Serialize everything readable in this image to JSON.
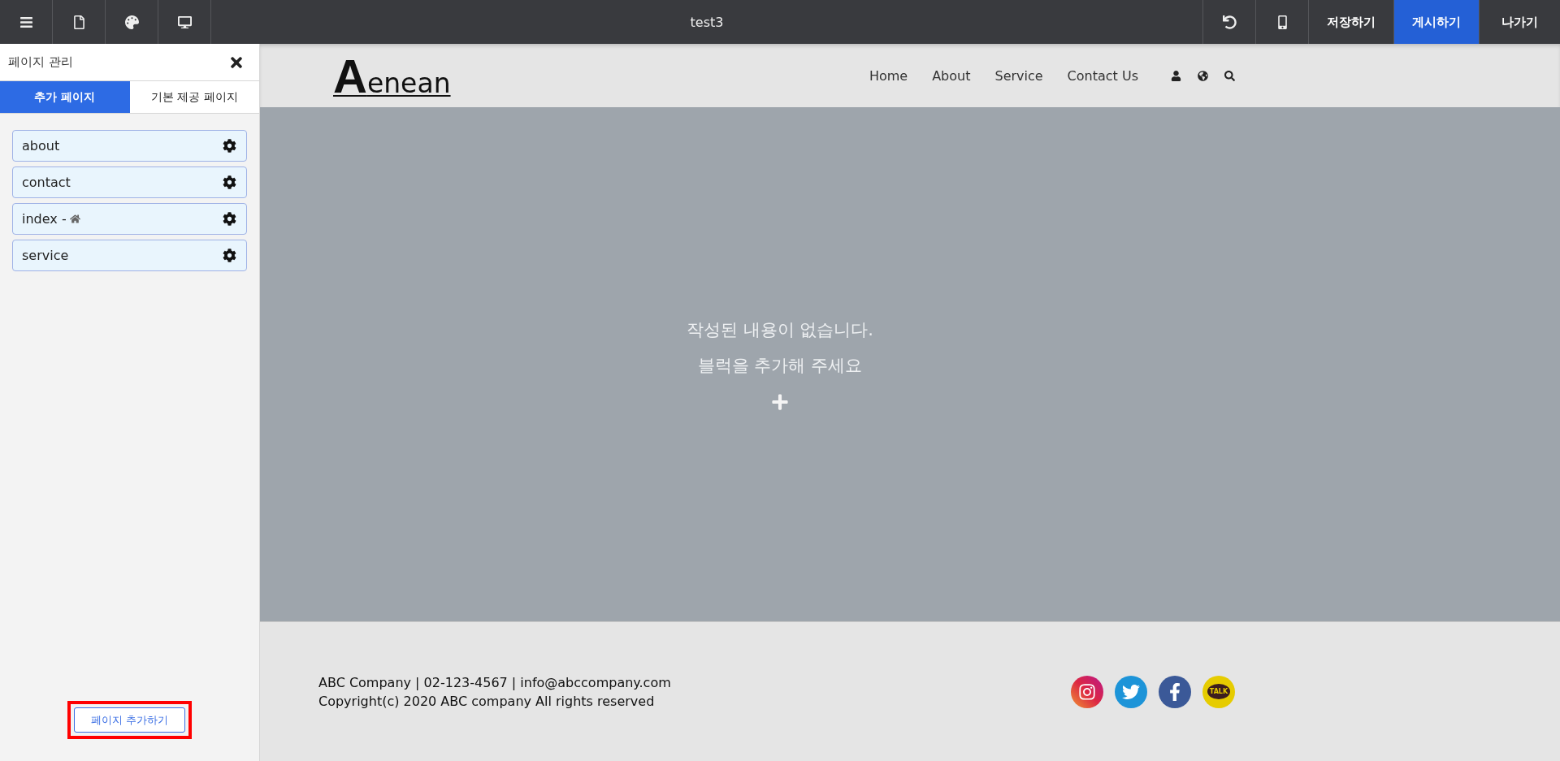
{
  "toolbar": {
    "title": "test3",
    "actions": [
      {
        "label": "저장하기",
        "primary": false
      },
      {
        "label": "게시하기",
        "primary": true
      },
      {
        "label": "나가기",
        "primary": false
      }
    ]
  },
  "sidebar": {
    "title": "페이지 관리",
    "tabs": [
      {
        "label": "추가 페이지",
        "selected": true
      },
      {
        "label": "기본 제공 페이지",
        "selected": false
      }
    ],
    "pages": [
      {
        "name": "about",
        "home": false
      },
      {
        "name": "contact",
        "home": false
      },
      {
        "name": "index",
        "suffix": "-",
        "home": true
      },
      {
        "name": "service",
        "home": false
      }
    ],
    "add_button": {
      "label": "페이지 추가하기",
      "highlighted": true
    }
  },
  "site": {
    "logo_initial": "A",
    "logo_rest": "enean",
    "nav": [
      "Home",
      "About",
      "Service",
      "Contact Us"
    ],
    "empty_message": [
      "작성된 내용이 없습니다.",
      "블럭을 추가해 주세요"
    ],
    "footer": {
      "lines": [
        "ABC Company | 02-123-4567 | info@abccompany.com",
        "Copyright(c) 2020 ABC company All rights reserved"
      ],
      "social": [
        {
          "kind": "instagram"
        },
        {
          "kind": "twitter"
        },
        {
          "kind": "facebook"
        },
        {
          "kind": "kakao",
          "label": "TALK"
        }
      ]
    }
  }
}
